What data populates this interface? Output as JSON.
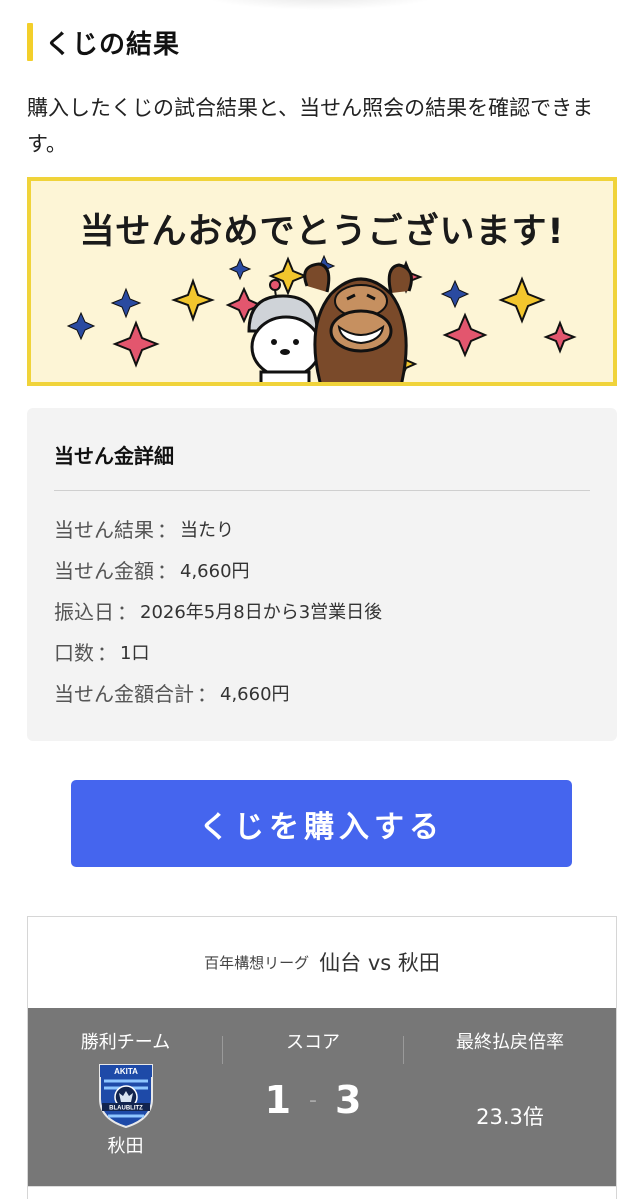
{
  "section": {
    "title": "くじの結果"
  },
  "description": "購入したくじの試合結果と、当せん照会の結果を確認できます。",
  "banner": {
    "headline": "当せんおめでとうございます!"
  },
  "detail": {
    "title": "当せん金詳細",
    "separator": "：",
    "rows": [
      {
        "label": "当せん結果",
        "value": "当たり"
      },
      {
        "label": "当せん金額",
        "value": "4,660円"
      },
      {
        "label": "振込日",
        "value": "2026年5月8日から3営業日後"
      },
      {
        "label": "口数",
        "value": "1口"
      },
      {
        "label": "当せん金額合計",
        "value": "4,660円"
      }
    ]
  },
  "buy_button": {
    "label": "くじを購入する"
  },
  "match": {
    "league": "百年構想リーグ",
    "teams": "仙台 vs 秋田",
    "winner_label": "勝利チーム",
    "winner_team": "秋田",
    "emblem_top_text": "AKITA",
    "emblem_band_text": "BLAUBLITZ",
    "score_label": "スコア",
    "home_score": "1",
    "score_sep": "-",
    "away_score": "3",
    "odds_label": "最終払戻倍率",
    "odds_value": "23.3倍"
  },
  "colors": {
    "accent_yellow": "#f3cf2a",
    "button_blue": "#4565ee",
    "result_bar_gray": "#777777",
    "banner_bg": "#fdf5d6"
  }
}
